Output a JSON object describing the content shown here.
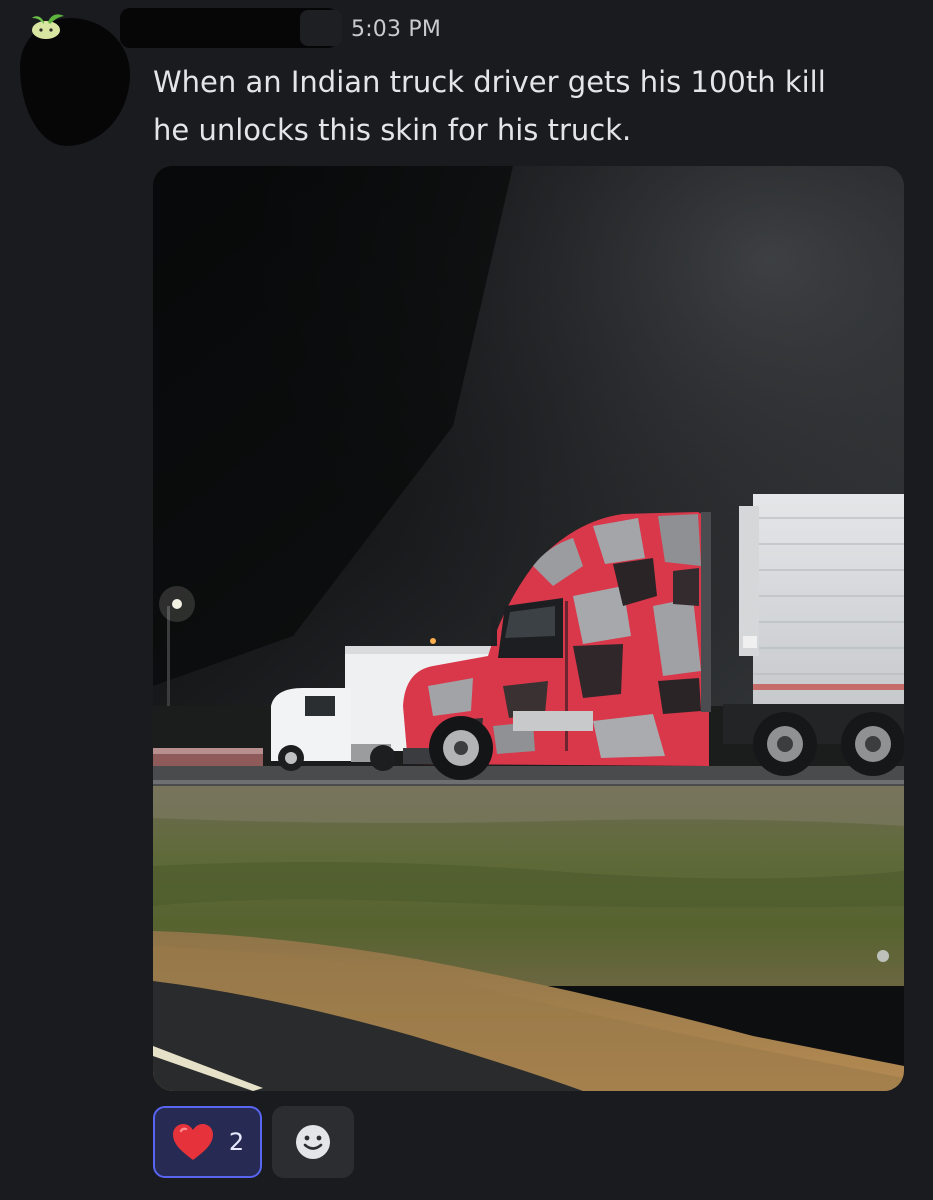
{
  "message": {
    "timestamp": "5:03 PM",
    "lines": [
      "When an Indian truck driver gets his 100th kill",
      "he unlocks this skin for his truck."
    ]
  },
  "reactions": [
    {
      "emoji": "heart-icon",
      "count": "2",
      "selected": true
    }
  ],
  "add_reaction": {
    "icon": "smiley-icon"
  },
  "colors": {
    "background": "#1a1b1f",
    "reaction_selected_bg": "#272a52",
    "reaction_selected_border": "#5865f2",
    "heart": "#e5323b"
  }
}
